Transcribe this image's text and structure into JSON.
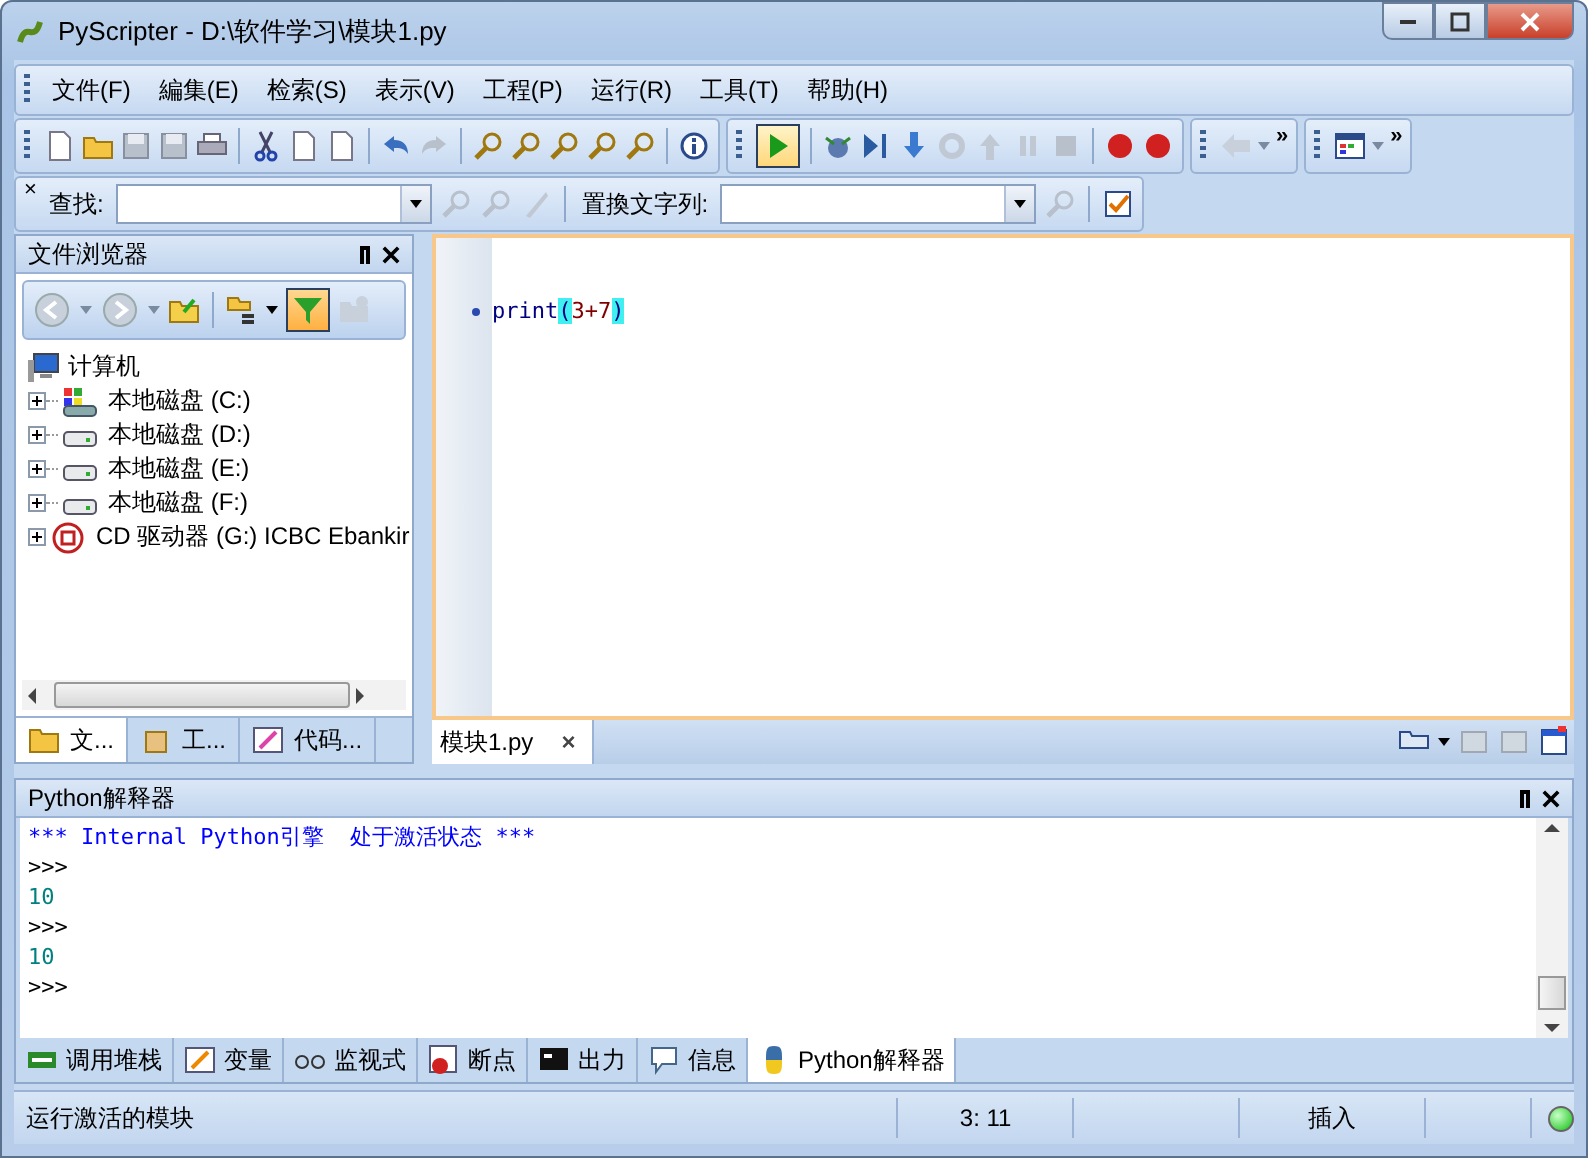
{
  "window": {
    "title": "PyScripter - D:\\软件学习\\模块1.py"
  },
  "menu": [
    "文件(F)",
    "編集(E)",
    "检索(S)",
    "表示(V)",
    "工程(P)",
    "运行(R)",
    "工具(T)",
    "帮助(H)"
  ],
  "toolbar": {
    "run_active": true,
    "overflow": [
      "»",
      "»"
    ]
  },
  "find_bar": {
    "close": "×",
    "find_label": "查找:",
    "replace_label": "置換文字列:"
  },
  "file_browser": {
    "title": "文件浏览器",
    "filter_active": true,
    "tree": [
      {
        "label": "计算机",
        "kind": "computer",
        "expanded": true,
        "children": [
          {
            "label": "本地磁盘 (C:)",
            "kind": "system_drive",
            "expanded": false
          },
          {
            "label": "本地磁盘 (D:)",
            "kind": "drive",
            "expanded": false
          },
          {
            "label": "本地磁盘 (E:)",
            "kind": "drive",
            "expanded": false
          },
          {
            "label": "本地磁盘 (F:)",
            "kind": "drive",
            "expanded": false
          },
          {
            "label": "CD 驱动器 (G:) ICBC Ebankir",
            "kind": "cd",
            "expanded": false
          }
        ]
      }
    ],
    "tabs": [
      {
        "label": "文...",
        "selected": true
      },
      {
        "label": "工...",
        "selected": false
      },
      {
        "label": "代码...",
        "selected": false
      }
    ]
  },
  "editor": {
    "lines": [
      [
        {
          "text": "print",
          "kind": "ident"
        },
        {
          "text": "(",
          "kind": "brace"
        },
        {
          "text": "3+7",
          "kind": "number"
        },
        {
          "text": ")",
          "kind": "brace"
        }
      ]
    ],
    "tabs": [
      {
        "label": "模块1.py",
        "close": "×",
        "selected": true
      }
    ]
  },
  "interpreter": {
    "title": "Python解释器",
    "lines": [
      {
        "text": "*** Internal Python引擎  处于激活状态 ***",
        "kind": "banner"
      },
      {
        "text": ">>>",
        "kind": "prompt"
      },
      {
        "text": "10",
        "kind": "output"
      },
      {
        "text": ">>>",
        "kind": "prompt"
      },
      {
        "text": "10",
        "kind": "output"
      },
      {
        "text": ">>>",
        "kind": "prompt"
      }
    ]
  },
  "bottom_tabs": [
    {
      "label": "调用堆栈",
      "selected": false
    },
    {
      "label": "变量",
      "selected": false
    },
    {
      "label": "监视式",
      "selected": false
    },
    {
      "label": "断点",
      "selected": false
    },
    {
      "label": "出力",
      "selected": false
    },
    {
      "label": "信息",
      "selected": false
    },
    {
      "label": "Python解释器",
      "selected": true
    }
  ],
  "status_bar": {
    "message": "运行激活的模块",
    "position": "3: 11",
    "mode": "插入",
    "engine_ok": true
  }
}
